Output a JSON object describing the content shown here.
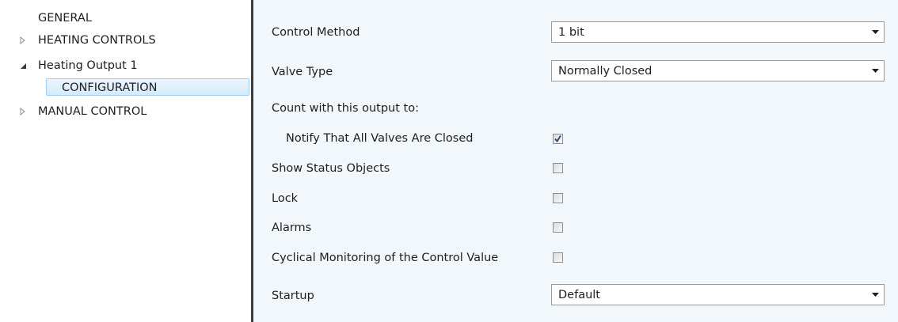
{
  "tree": {
    "items": [
      {
        "label": "GENERAL",
        "expander": "none"
      },
      {
        "label": "HEATING CONTROLS",
        "expander": "collapsed"
      },
      {
        "label": "Heating Output 1",
        "expander": "expanded"
      },
      {
        "label": "CONFIGURATION",
        "expander": "none",
        "selected": true
      },
      {
        "label": "MANUAL CONTROL",
        "expander": "collapsed"
      }
    ]
  },
  "form": {
    "control_method": {
      "label": "Control Method",
      "value": "1 bit"
    },
    "valve_type": {
      "label": "Valve Type",
      "value": "Normally Closed"
    },
    "count_header": {
      "label": "Count with this output to:"
    },
    "notify_valves_closed": {
      "label": "Notify That All Valves Are Closed",
      "checked": true
    },
    "show_status_objects": {
      "label": "Show Status Objects",
      "checked": false
    },
    "lock": {
      "label": "Lock",
      "checked": false
    },
    "alarms": {
      "label": "Alarms",
      "checked": false
    },
    "cyclical_monitoring": {
      "label": "Cyclical Monitoring of the Control Value",
      "checked": false
    },
    "startup": {
      "label": "Startup",
      "value": "Default"
    }
  },
  "colors": {
    "panel_background": "#f2f7fb",
    "selection_fill": "#d4ebfb",
    "selection_border": "#9fcff2",
    "splitter": "#3c3c3c",
    "check_mark": "#2c3a7a"
  }
}
